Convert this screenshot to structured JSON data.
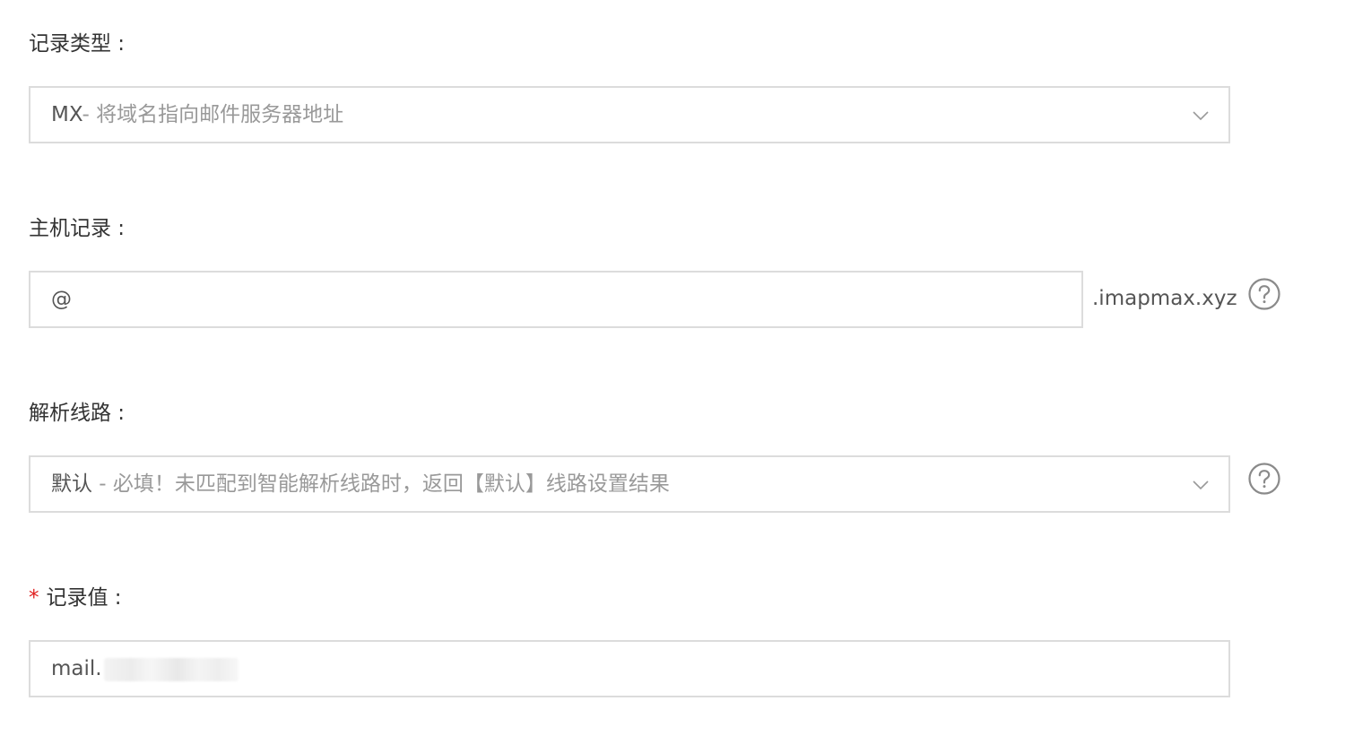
{
  "record_type": {
    "label": "记录类型 :",
    "value_main": "MX",
    "value_sub": "- 将域名指向邮件服务器地址",
    "icon": "chevron-down-icon"
  },
  "host_record": {
    "label": "主机记录 :",
    "value": "@",
    "suffix": ".imapmax.xyz",
    "help_icon": "question-circle-icon"
  },
  "resolution_line": {
    "label": "解析线路 :",
    "value_main": "默认",
    "value_sub": " - 必填！未匹配到智能解析线路时，返回【默认】线路设置结果",
    "icon": "chevron-down-icon",
    "help_icon": "question-circle-icon"
  },
  "record_value": {
    "required_mark": "*",
    "label": "记录值 :",
    "value_visible": "mail."
  },
  "colors": {
    "border": "#dcdcdc",
    "text": "#333333",
    "muted": "#999999",
    "required": "#e02020"
  }
}
